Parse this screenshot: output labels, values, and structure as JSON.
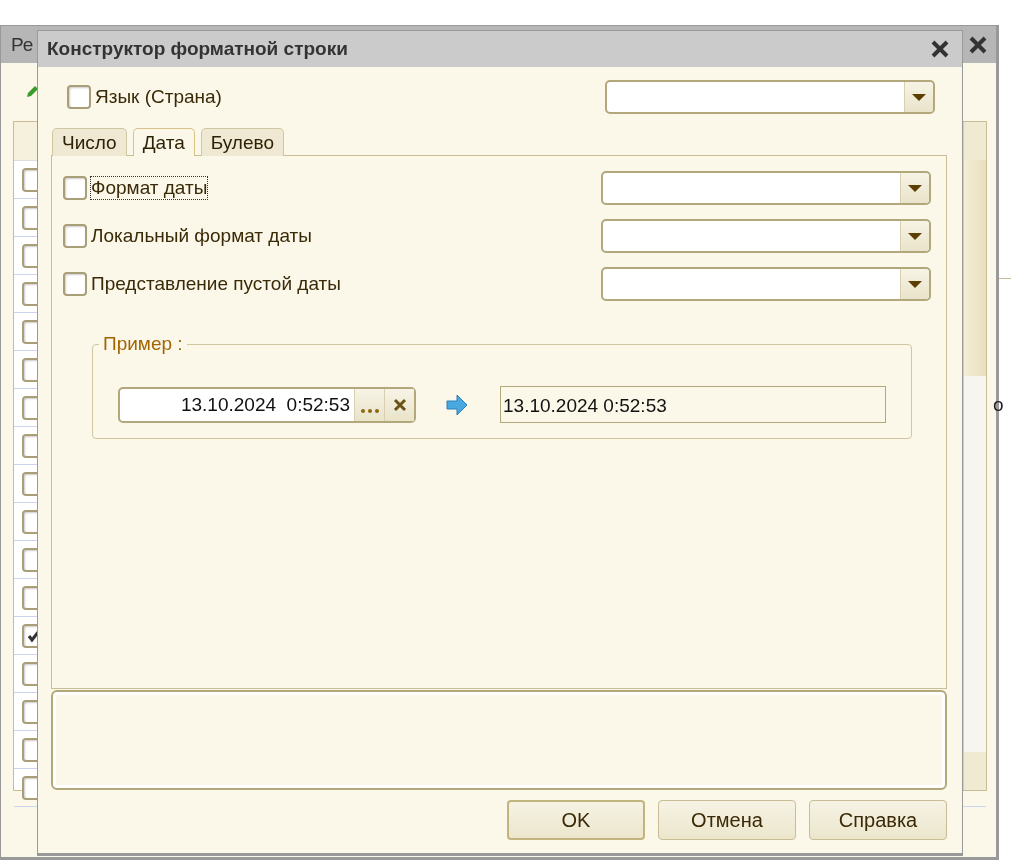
{
  "background_window": {
    "title": "Ре",
    "side_text": "о",
    "rows": [
      {
        "checked": false
      },
      {
        "checked": false
      },
      {
        "checked": false
      },
      {
        "checked": false
      },
      {
        "checked": false
      },
      {
        "checked": false
      },
      {
        "checked": false
      },
      {
        "checked": false
      },
      {
        "checked": false
      },
      {
        "checked": false
      },
      {
        "checked": false
      },
      {
        "checked": false
      },
      {
        "checked": true
      },
      {
        "checked": false
      },
      {
        "checked": false
      },
      {
        "checked": false
      },
      {
        "checked": false
      }
    ]
  },
  "dialog": {
    "title": "Конструктор форматной строки",
    "language": {
      "label": "Язык (Страна)",
      "checked": false
    },
    "tabs": [
      {
        "label": "Число",
        "selected": false
      },
      {
        "label": "Дата",
        "selected": true
      },
      {
        "label": "Булево",
        "selected": false
      }
    ],
    "options": [
      {
        "label": "Формат даты",
        "checked": false,
        "focused": true
      },
      {
        "label": "Локальный формат даты",
        "checked": false,
        "focused": false
      },
      {
        "label": "Представление пустой даты",
        "checked": false,
        "focused": false
      }
    ],
    "example": {
      "legend": "Пример :",
      "input": "13.10.2024  0:52:53",
      "result": "13.10.2024 0:52:53"
    },
    "buttons": [
      {
        "label": "OK",
        "default": true
      },
      {
        "label": "Отмена",
        "default": false
      },
      {
        "label": "Справка",
        "default": false
      }
    ]
  }
}
